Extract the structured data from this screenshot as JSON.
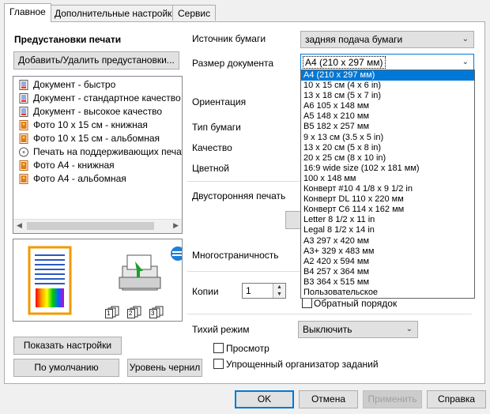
{
  "tabs": [
    {
      "label": "Главное"
    },
    {
      "label": "Дополнительные настройки"
    },
    {
      "label": "Сервис"
    }
  ],
  "presets": {
    "title": "Предустановки печати",
    "add_remove_button": "Добавить/Удалить предустановки...",
    "items": [
      {
        "label": "Документ - быстро",
        "icon": "document-icon"
      },
      {
        "label": "Документ - стандартное качество",
        "icon": "document-icon"
      },
      {
        "label": "Документ - высокое качество",
        "icon": "document-icon"
      },
      {
        "label": "Фото 10 x 15 см - книжная",
        "icon": "photo-icon"
      },
      {
        "label": "Фото 10 x 15 см - альбомная",
        "icon": "photo-icon"
      },
      {
        "label": "Печать на поддерживающих печать",
        "icon": "disc-icon"
      },
      {
        "label": "Фото A4 - книжная",
        "icon": "photo-icon"
      },
      {
        "label": "Фото A4 - альбомная",
        "icon": "photo-icon"
      }
    ]
  },
  "left_buttons": {
    "show_settings": "Показать настройки",
    "defaults": "По умолчанию",
    "ink_levels": "Уровень чернил"
  },
  "form": {
    "paper_source_label": "Источник бумаги",
    "paper_source_value": "задняя подача бумаги",
    "doc_size_label": "Размер документа",
    "doc_size_value": "A4 (210 x 297 мм)",
    "orientation_label": "Ориентация",
    "paper_type_label": "Тип бумаги",
    "quality_label": "Качество",
    "color_label": "Цветной",
    "duplex_label": "Двусторонняя печать",
    "multipage_label": "Многостраничность",
    "copies_label": "Копии",
    "copies_value": "1",
    "reverse_order_label": "Обратный порядок",
    "quiet_mode_label": "Тихий режим",
    "quiet_mode_value": "Выключить",
    "preview_label": "Просмотр",
    "job_arranger_label": "Упрощенный организатор заданий"
  },
  "doc_size_options": [
    "A4 (210 x 297 мм)",
    "10 x 15 см (4 x 6 in)",
    "13 x 18 см (5 x 7 in)",
    "A6 105 x 148 мм",
    "A5 148 x 210 мм",
    "B5 182 x 257 мм",
    "9 x 13 см (3.5 x 5 in)",
    "13 x 20 см (5 x 8 in)",
    "20 x 25 см (8 x 10 in)",
    "16:9 wide size (102 x 181 мм)",
    "100 x 148 мм",
    "Конверт #10 4 1/8 x 9 1/2 in",
    "Конверт DL  110 x 220 мм",
    "Конверт C6  114 x 162 мм",
    "Letter 8 1/2 x 11 in",
    "Legal 8 1/2 x 14 in",
    "A3 297 x 420 мм",
    "A3+ 329 x 483 мм",
    "A2 420 x 594 мм",
    "B4 257 x 364 мм",
    "B3 364 x 515 мм",
    "Пользовательское"
  ],
  "bottom_buttons": {
    "ok": "OK",
    "cancel": "Отмена",
    "apply": "Применить",
    "help": "Справка"
  },
  "preview_icons": {
    "copies_icons": [
      "1",
      "2",
      "3"
    ]
  },
  "colors": {
    "accent": "#0078d7",
    "selection": "#0078d7"
  }
}
